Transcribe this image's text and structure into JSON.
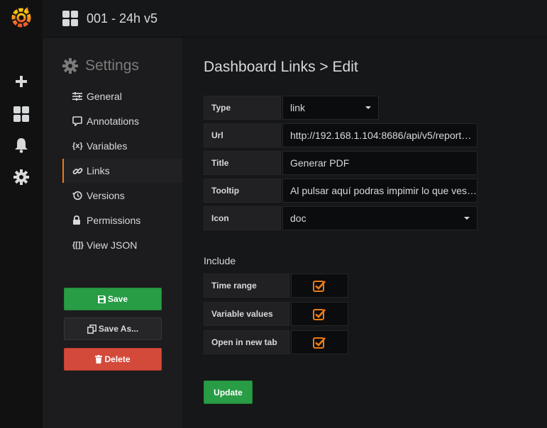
{
  "topbar": {
    "dashboard_title": "001 - 24h v5"
  },
  "sidemenu": {
    "icons": [
      "grafana-logo-icon",
      "plus-icon",
      "dashboards-icon",
      "bell-icon",
      "gear-icon"
    ]
  },
  "settings_nav": {
    "title": "Settings",
    "items": [
      {
        "label": "General",
        "icon": "sliders-icon"
      },
      {
        "label": "Annotations",
        "icon": "comment-icon"
      },
      {
        "label": "Variables",
        "icon": "variable-icon"
      },
      {
        "label": "Links",
        "icon": "link-icon",
        "active": true
      },
      {
        "label": "Versions",
        "icon": "history-icon"
      },
      {
        "label": "Permissions",
        "icon": "lock-icon"
      },
      {
        "label": "View JSON",
        "icon": "json-icon"
      }
    ],
    "save_label": "Save",
    "save_as_label": "Save As...",
    "delete_label": "Delete"
  },
  "main": {
    "heading": "Dashboard Links > Edit",
    "fields": {
      "type": {
        "label": "Type",
        "value": "link"
      },
      "url": {
        "label": "Url",
        "value": "http://192.168.1.104:8686/api/v5/report…"
      },
      "title": {
        "label": "Title",
        "value": "Generar PDF"
      },
      "tooltip": {
        "label": "Tooltip",
        "value": "Al pulsar aquí podras impimir lo que ves…"
      },
      "icon": {
        "label": "Icon",
        "value": "doc"
      }
    },
    "include_title": "Include",
    "checks": [
      {
        "label": "Time range",
        "checked": true
      },
      {
        "label": "Variable values",
        "checked": true
      },
      {
        "label": "Open in new tab",
        "checked": true
      }
    ],
    "update_label": "Update"
  },
  "colors": {
    "accent": "#eb7b18",
    "success": "#299c46",
    "danger": "#d44a3a"
  }
}
